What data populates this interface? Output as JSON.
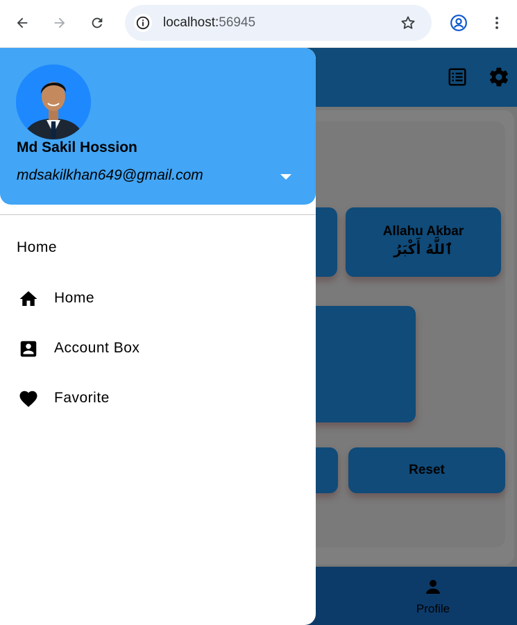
{
  "browser": {
    "url_host": "localhost:",
    "url_port": "56945",
    "icons": [
      "back-arrow-icon",
      "forward-arrow-icon",
      "reload-icon",
      "site-info-icon",
      "bookmark-star-icon",
      "profile-icon",
      "more-vert-icon"
    ]
  },
  "app": {
    "appbar_actions": [
      "list-icon",
      "settings-icon"
    ],
    "tiles": [
      {
        "line1": "Allahu Akbar",
        "line2": "ٱللَّهُ أَكْبَرُ"
      },
      {
        "line1": "Reset"
      }
    ],
    "bottom_nav": {
      "profile_label": "Profile"
    },
    "colors": {
      "primary": "#2196f3",
      "bottom_bar": "#1976d2"
    }
  },
  "drawer": {
    "account": {
      "name": "Md Sakil Hossion",
      "email": "mdsakilkhan649@gmail.com"
    },
    "section_title": "Home",
    "items": [
      {
        "label": "Home",
        "icon": "home-icon"
      },
      {
        "label": "Account Box",
        "icon": "account-box-icon"
      },
      {
        "label": "Favorite",
        "icon": "favorite-icon"
      }
    ],
    "colors": {
      "header": "#42a5f5"
    }
  }
}
